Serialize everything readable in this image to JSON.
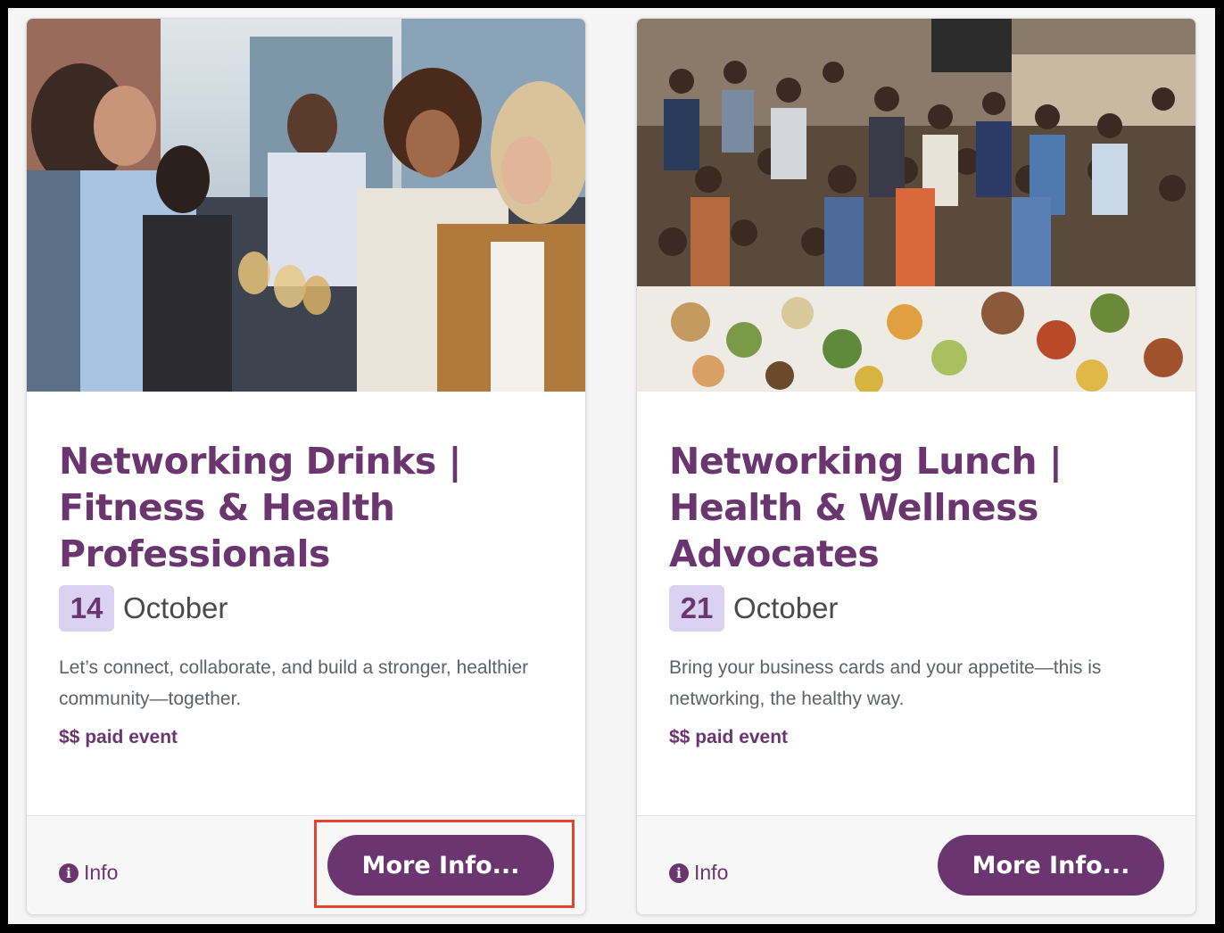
{
  "cards": [
    {
      "title": "Networking Drinks | Fitness & Health Professionals",
      "day": "14",
      "month": "October",
      "description": "Let’s connect, collaborate, and build a stronger, healthier community—together.",
      "price": "$$ paid event",
      "info_label": "Info",
      "button_label": "More Info..."
    },
    {
      "title": "Networking Lunch | Health & Wellness Advocates",
      "day": "21",
      "month": "October",
      "description": "Bring your business cards and your appetite—this is networking, the healthy way.",
      "price": "$$ paid event",
      "info_label": "Info",
      "button_label": "More Info..."
    }
  ],
  "colors": {
    "brand": "#6b3570",
    "date_badge": "#d9d3f1",
    "highlight": "#e0462f"
  },
  "icons": [
    "info-icon"
  ]
}
